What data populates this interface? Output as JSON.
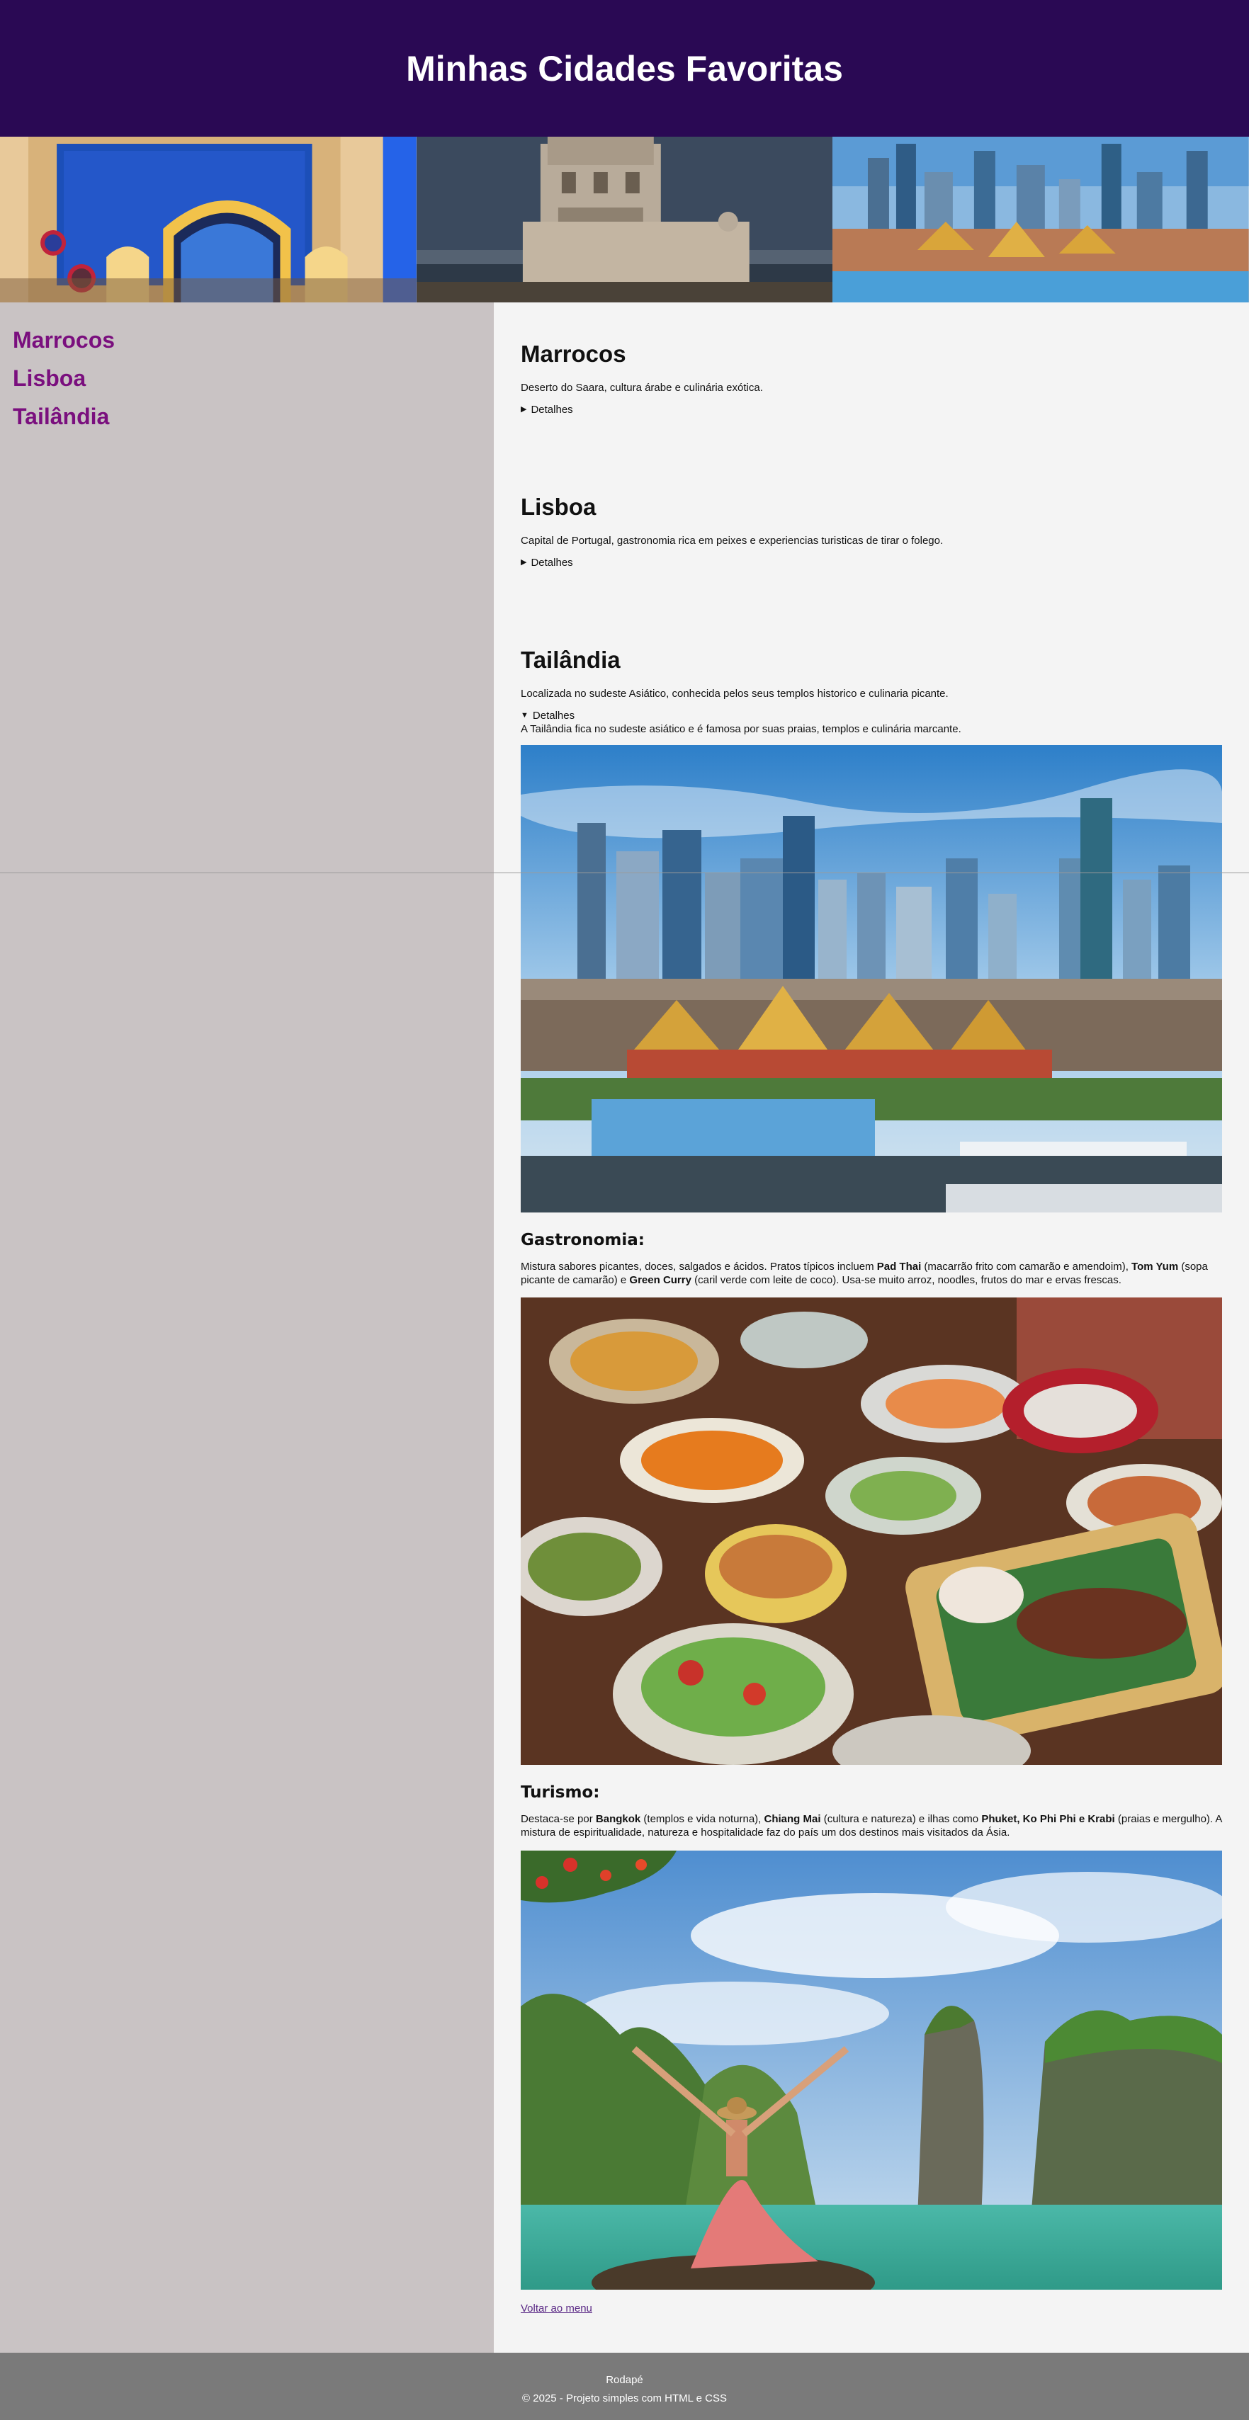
{
  "header": {
    "title": "Minhas Cidades Favoritas"
  },
  "banner": [
    {
      "name": "Marrocos"
    },
    {
      "name": "Lisboa"
    },
    {
      "name": "Tailândia"
    }
  ],
  "sidebar": {
    "items": [
      {
        "label": "Marrocos"
      },
      {
        "label": "Lisboa"
      },
      {
        "label": "Tailândia"
      }
    ]
  },
  "sections": {
    "marrocos": {
      "title": "Marrocos",
      "desc": "Deserto do Saara, cultura árabe e culinária exótica.",
      "details": "Detalhes"
    },
    "lisboa": {
      "title": "Lisboa",
      "desc": "Capital de Portugal, gastronomia rica em peixes e experiencias turisticas de tirar o folego.",
      "details": "Detalhes"
    },
    "tailandia": {
      "title": "Tailândia",
      "desc": "Localizada no sudeste Asiático, conhecida pelos seus templos historico e culinaria picante.",
      "details": "Detalhes",
      "details_text": "A Tailândia fica no sudeste asiático e é famosa por suas praias, templos e culinária marcante.",
      "gastronomia": {
        "title": "Gastronomia:",
        "t1": "Mistura sabores picantes, doces, salgados e ácidos. Pratos típicos incluem ",
        "b1": "Pad Thai",
        "t2": " (macarrão frito com camarão e amendoim), ",
        "b2": "Tom Yum",
        "t3": " (sopa picante de camarão) e ",
        "b3": "Green Curry",
        "t4": " (caril verde com leite de coco). Usa-se muito arroz, noodles, frutos do mar e ervas frescas."
      },
      "turismo": {
        "title": "Turismo:",
        "t1": "Destaca-se por ",
        "b1": "Bangkok",
        "t2": " (templos e vida noturna), ",
        "b2": "Chiang Mai",
        "t3": " (cultura e natureza) e ilhas como ",
        "b3": "Phuket, Ko Phi Phi e Krabi",
        "t4": " (praias e mergulho). A mistura de espiritualidade, natureza e hospitalidade faz do país um dos destinos mais visitados da Ásia."
      },
      "back_link": "Voltar ao menu"
    }
  },
  "footer": {
    "line1": "Rodapé",
    "line2": "© 2025 - Projeto simples com HTML e CSS"
  },
  "colors": {
    "header_bg": "#2a0954",
    "sidebar_bg": "#c9c3c4",
    "sidebar_link": "#7a0f7e",
    "content_bg": "#f4f4f4",
    "footer_bg": "#7a7a7a"
  }
}
